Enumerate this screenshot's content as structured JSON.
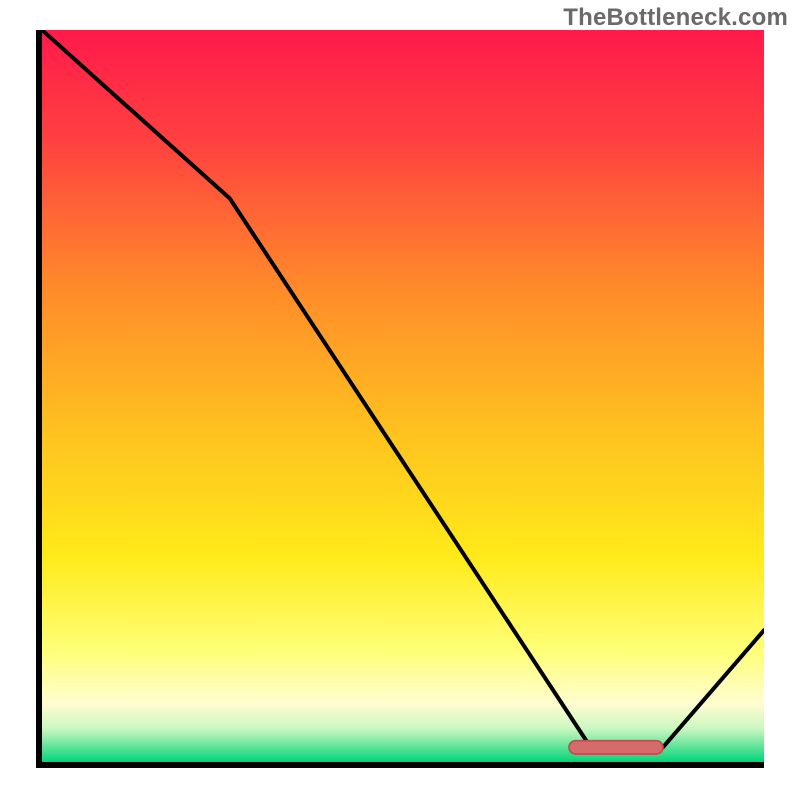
{
  "watermark": {
    "text": "TheBottleneck.com"
  },
  "colors": {
    "axis": "#000000",
    "curve": "#000000",
    "marker_fill": "#d66b6b",
    "marker_stroke": "#c24e4e",
    "gradient_stops": [
      {
        "offset": 0.0,
        "color": "#ff1a4b"
      },
      {
        "offset": 0.15,
        "color": "#ff4040"
      },
      {
        "offset": 0.35,
        "color": "#ff8a2a"
      },
      {
        "offset": 0.55,
        "color": "#ffc21f"
      },
      {
        "offset": 0.72,
        "color": "#ffea1a"
      },
      {
        "offset": 0.85,
        "color": "#ffff7a"
      },
      {
        "offset": 0.92,
        "color": "#fffdd0"
      },
      {
        "offset": 0.955,
        "color": "#c9f7c0"
      },
      {
        "offset": 0.978,
        "color": "#63e59a"
      },
      {
        "offset": 1.0,
        "color": "#00d47a"
      }
    ]
  },
  "chart_data": {
    "type": "line",
    "title": "",
    "xlabel": "",
    "ylabel": "",
    "xlim": [
      0,
      100
    ],
    "ylim": [
      0,
      100
    ],
    "series": [
      {
        "name": "bottleneck-curve",
        "x": [
          0,
          26,
          76,
          86,
          100
        ],
        "y": [
          100,
          77,
          2,
          2,
          18
        ]
      }
    ],
    "marker": {
      "name": "optimal-range",
      "x_start": 73,
      "x_end": 86,
      "y": 2,
      "shape": "rounded-bar"
    }
  }
}
